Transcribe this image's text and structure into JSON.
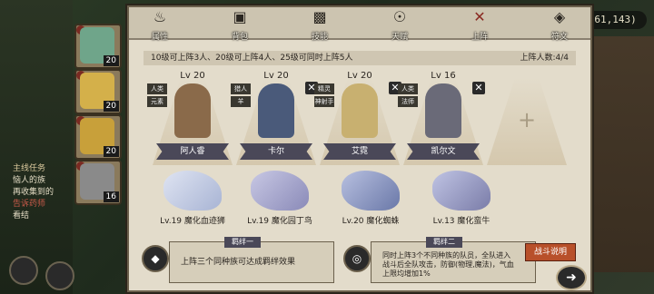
{
  "hud": {
    "coordinates": "(161,143)"
  },
  "quest": {
    "title": "主线任务",
    "lines": [
      "恼人的族",
      "再收集到的",
      "告诉药师",
      "看结"
    ]
  },
  "party": [
    {
      "level": "20",
      "color": "#6fa58a"
    },
    {
      "level": "20",
      "color": "#d4b04a"
    },
    {
      "level": "20",
      "color": "#c8a03a"
    },
    {
      "level": "16",
      "color": "#8a8a8a"
    }
  ],
  "tabs": [
    {
      "label": "属性",
      "icon": "flame-icon"
    },
    {
      "label": "背包",
      "icon": "bag-icon"
    },
    {
      "label": "技能",
      "icon": "book-icon"
    },
    {
      "label": "天赋",
      "icon": "eye-icon"
    },
    {
      "label": "上阵",
      "icon": "swords-icon",
      "active": true
    },
    {
      "label": "符文",
      "icon": "rune-icon"
    }
  ],
  "info": {
    "rule": "10级可上阵3人、20级可上阵4人、25级可同时上阵5人",
    "count": "上阵人数:4/4"
  },
  "members": [
    {
      "level": "Lv 20",
      "name": "阿人睿",
      "tags": [
        "人类",
        "元素"
      ],
      "color": "#8a6a4a",
      "removable": false
    },
    {
      "level": "Lv 20",
      "name": "卡尔",
      "tags": [
        "猎人",
        "羊"
      ],
      "color": "#4a5a7a",
      "removable": true
    },
    {
      "level": "Lv 20",
      "name": "艾霓",
      "tags": [
        "精灵",
        "神射手"
      ],
      "color": "#c8b070",
      "removable": true
    },
    {
      "level": "Lv 16",
      "name": "凯尔文",
      "tags": [
        "人类",
        "法师"
      ],
      "color": "#6a6a78",
      "removable": true
    }
  ],
  "beasts": [
    {
      "label": "Lv.19 魔化血迹狮",
      "color": "#a8b4d4"
    },
    {
      "label": "Lv.19 魔化园丁鸟",
      "color": "#8a8ab8"
    },
    {
      "label": "Lv.20 魔化蜘蛛",
      "color": "#6a78a8"
    },
    {
      "label": "Lv.13 魔化蛮牛",
      "color": "#7a7ca8"
    }
  ],
  "bonds": {
    "one": {
      "title": "羁绊一",
      "desc": "上阵三个同种族可达成羁绊效果"
    },
    "two": {
      "title": "羁绊二",
      "line1": "同时上阵3个不同种族的队员，全队进入",
      "line2": "战斗后全队攻击，防御(物理,魔法)，气血",
      "line3": "上限均增加1%"
    }
  },
  "buttons": {
    "fight_info": "战斗说明"
  }
}
